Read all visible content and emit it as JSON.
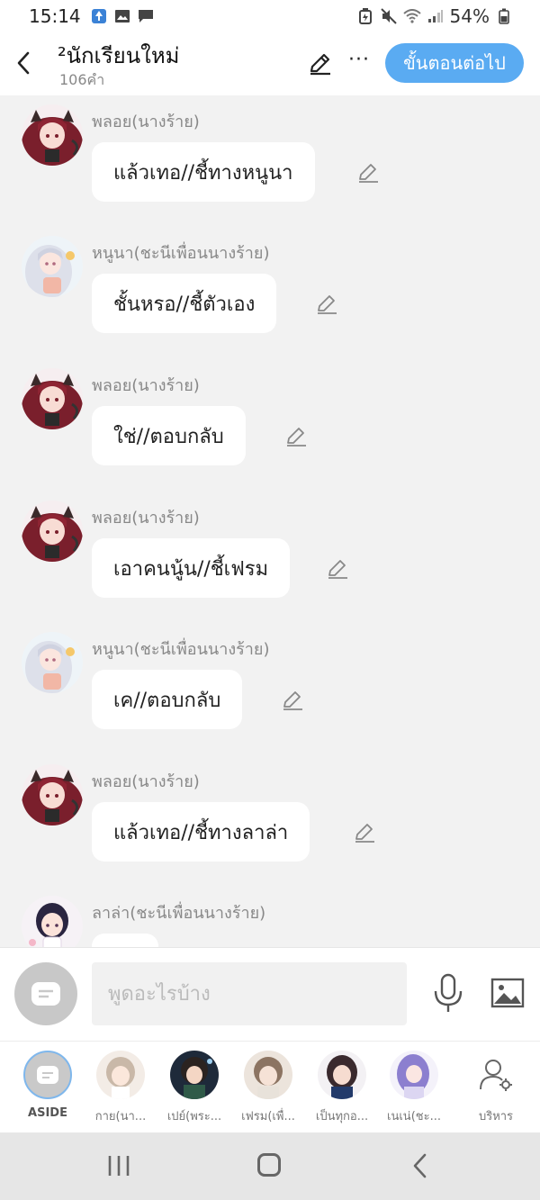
{
  "status_bar": {
    "time": "15:14",
    "battery": "54%",
    "icons_left": [
      "tree-app-icon",
      "gallery-icon",
      "message-icon"
    ],
    "icons_right": [
      "battery-saver-icon",
      "mute-icon",
      "wifi-icon",
      "signal-icon",
      "battery-icon"
    ]
  },
  "header": {
    "title": "²นักเรียนใหม่",
    "word_count": "106คำ",
    "next_label": "ขั้นตอนต่อไป",
    "more_label": "···"
  },
  "colors": {
    "accent": "#5aabf2",
    "background": "#f2f2f2",
    "bubble": "#ffffff",
    "speaker_text": "#888888"
  },
  "messages": [
    {
      "speaker": "พลอย(นางร้าย)",
      "text": "แล้วเทอ//ชี้ทางหนูนา",
      "avatar": "ploy"
    },
    {
      "speaker": "หนูนา(ชะนีเพื่อนนางร้าย)",
      "text": "ชั้นหรอ//ชี้ตัวเอง",
      "avatar": "nuna"
    },
    {
      "speaker": "พลอย(นางร้าย)",
      "text": "ใช่//ตอบกลับ",
      "avatar": "ploy"
    },
    {
      "speaker": "พลอย(นางร้าย)",
      "text": "เอาคนนู้น//ชี้เฟรม",
      "avatar": "ploy"
    },
    {
      "speaker": "หนูนา(ชะนีเพื่อนนางร้าย)",
      "text": "เค//ตอบกลับ",
      "avatar": "nuna"
    },
    {
      "speaker": "พลอย(นางร้าย)",
      "text": "แล้วเทอ//ชี้ทางลาล่า",
      "avatar": "ploy"
    },
    {
      "speaker": "ลาล่า(ชะนีเพื่อนนางร้าย)",
      "text": "",
      "avatar": "lala"
    }
  ],
  "input": {
    "placeholder": "พูดอะไรบ้าง"
  },
  "characters": [
    {
      "label": "ASIDE",
      "type": "aside"
    },
    {
      "label": "กาย(นา...",
      "type": "avatar"
    },
    {
      "label": "เปย์(พระ...",
      "type": "avatar"
    },
    {
      "label": "เฟรม(เพื่...",
      "type": "avatar"
    },
    {
      "label": "เป็นทุกอ...",
      "type": "avatar"
    },
    {
      "label": "เนเน่(ชะ...",
      "type": "avatar"
    },
    {
      "label": "บริหาร",
      "type": "manage"
    }
  ]
}
